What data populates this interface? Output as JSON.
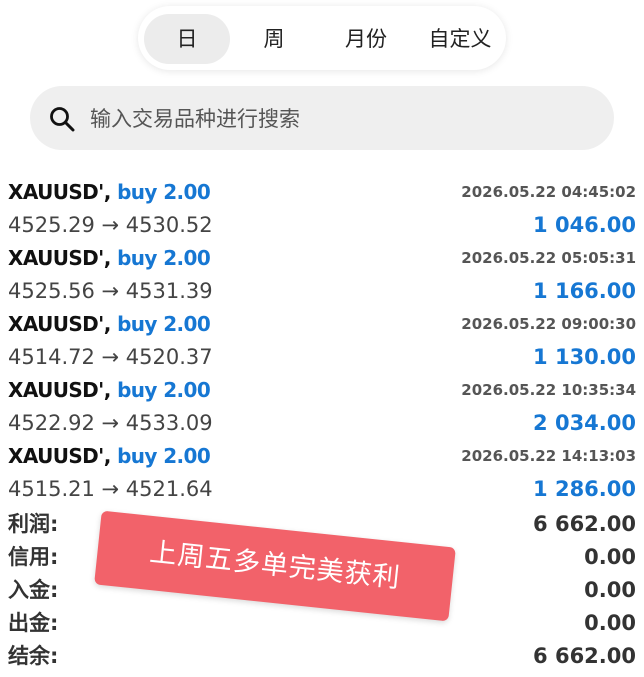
{
  "period_tabs": [
    {
      "label": "日",
      "active": true
    },
    {
      "label": "周",
      "active": false
    },
    {
      "label": "月份",
      "active": false
    },
    {
      "label": "自定义",
      "active": false
    }
  ],
  "search": {
    "placeholder": "输入交易品种进行搜索",
    "icon": "search-icon"
  },
  "trades": [
    {
      "symbol": "XAUUSD',",
      "side": "buy 2.00",
      "time": "2026.05.22 04:45:02",
      "prices": "4525.29 → 4530.52",
      "profit": "1 046.00"
    },
    {
      "symbol": "XAUUSD',",
      "side": "buy 2.00",
      "time": "2026.05.22 05:05:31",
      "prices": "4525.56 → 4531.39",
      "profit": "1 166.00"
    },
    {
      "symbol": "XAUUSD',",
      "side": "buy 2.00",
      "time": "2026.05.22 09:00:30",
      "prices": "4514.72 → 4520.37",
      "profit": "1 130.00"
    },
    {
      "symbol": "XAUUSD',",
      "side": "buy 2.00",
      "time": "2026.05.22 10:35:34",
      "prices": "4522.92 → 4533.09",
      "profit": "2 034.00"
    },
    {
      "symbol": "XAUUSD',",
      "side": "buy 2.00",
      "time": "2026.05.22 14:13:03",
      "prices": "4515.21 → 4521.64",
      "profit": "1 286.00"
    }
  ],
  "summary": [
    {
      "label": "利润:",
      "value": "6 662.00"
    },
    {
      "label": "信用:",
      "value": "0.00"
    },
    {
      "label": "入金:",
      "value": "0.00"
    },
    {
      "label": "出金:",
      "value": "0.00"
    },
    {
      "label": "结余:",
      "value": "6 662.00"
    }
  ],
  "overlay": {
    "text": "上周五多单完美获利"
  },
  "colors": {
    "accent_blue": "#1677d3",
    "sticker_red": "#f2626a",
    "search_bg": "#efefef"
  }
}
